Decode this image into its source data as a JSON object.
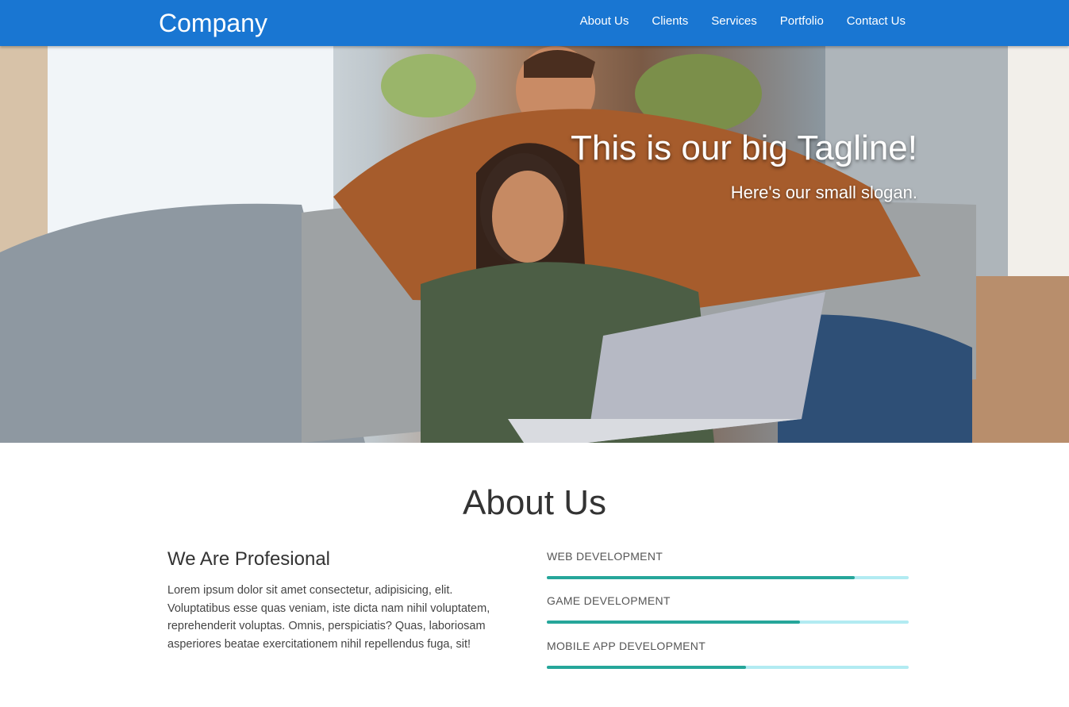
{
  "header": {
    "brand": "Company",
    "nav": [
      "About Us",
      "Clients",
      "Services",
      "Portfolio",
      "Contact Us"
    ],
    "background_color": "#1976d2"
  },
  "hero": {
    "tagline": "This is our big Tagline!",
    "slogan": "Here's our small slogan."
  },
  "about": {
    "title": "About Us",
    "subtitle": "We Are Profesional",
    "text": "Lorem ipsum dolor sit amet consectetur, adipisicing, elit. Voluptatibus esse quas veniam, iste dicta nam nihil voluptatem, reprehenderit voluptas. Omnis, perspiciatis? Quas, laboriosam asperiores beatae exercitationem nihil repellendus fuga, sit!",
    "skills": [
      {
        "label": "WEB DEVELOPMENT",
        "progress": 0.85
      },
      {
        "label": "GAME DEVELOPMENT",
        "progress": 0.7
      },
      {
        "label": "MOBILE APP DEVELOPMENT",
        "progress": 0.55
      }
    ],
    "colors": {
      "bar_fill": "#26a69a",
      "bar_track": "#b2ebf2"
    }
  }
}
